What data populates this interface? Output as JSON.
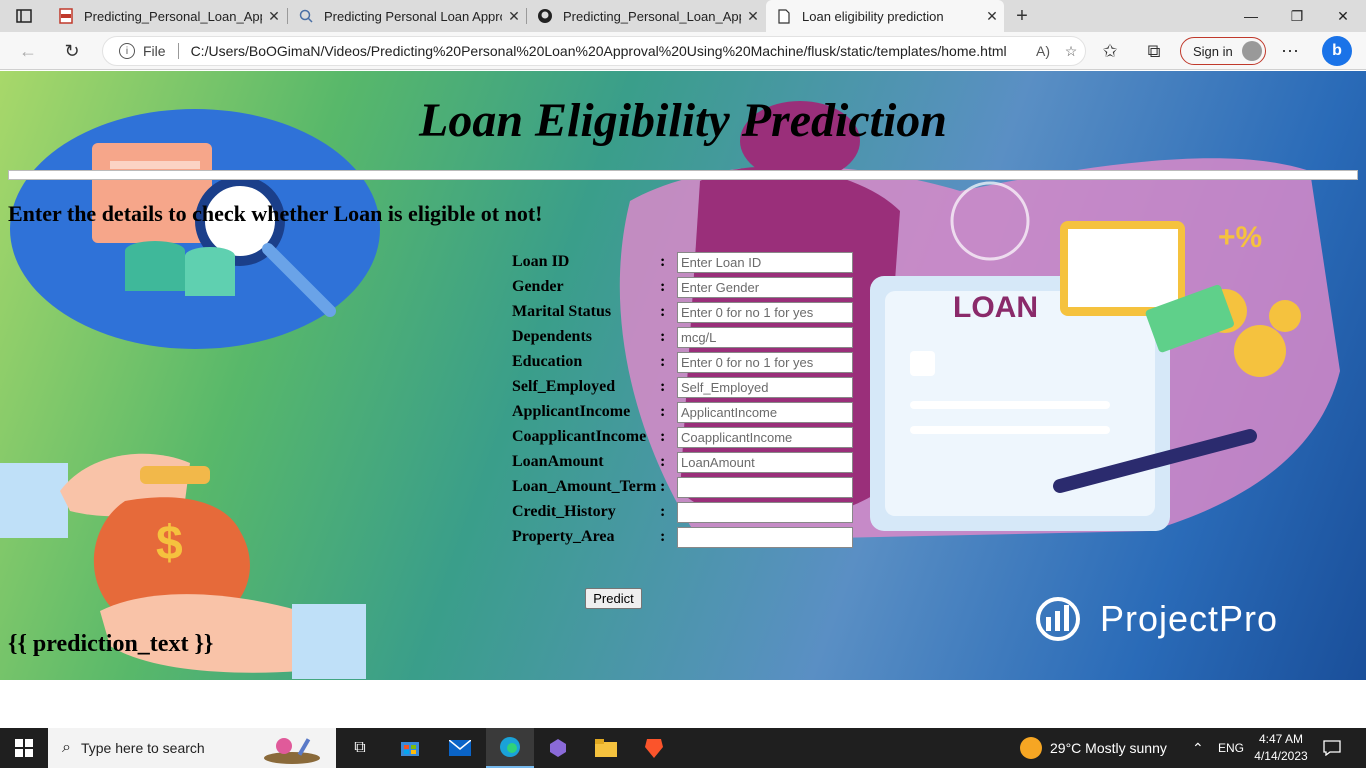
{
  "browser": {
    "tabs": [
      {
        "title": "Predicting_Personal_Loan_Appro",
        "icon": "pdf-icon"
      },
      {
        "title": "Predicting Personal Loan Approv",
        "icon": "search-icon"
      },
      {
        "title": "Predicting_Personal_Loan_Appro",
        "icon": "github-icon"
      },
      {
        "title": "Loan eligibility prediction",
        "icon": "document-icon",
        "active": true
      }
    ],
    "file_label": "File",
    "url": "C:/Users/BoOGimaN/Videos/Predicting%20Personal%20Loan%20Approval%20Using%20Machine/flusk/static/templates/home.html",
    "signin_label": "Sign in"
  },
  "page": {
    "title": "Loan Eligibility Prediction",
    "subtitle": "Enter the details to check whether Loan is eligible ot not!",
    "colon": ":",
    "fields": [
      {
        "label": "Loan ID",
        "placeholder": "Enter Loan ID"
      },
      {
        "label": "Gender",
        "placeholder": "Enter Gender"
      },
      {
        "label": "Marital Status",
        "placeholder": "Enter 0 for no 1 for yes"
      },
      {
        "label": "Dependents",
        "placeholder": "mcg/L"
      },
      {
        "label": "Education",
        "placeholder": "Enter 0 for no 1 for yes"
      },
      {
        "label": "Self_Employed",
        "placeholder": "Self_Employed"
      },
      {
        "label": "ApplicantIncome",
        "placeholder": "ApplicantIncome"
      },
      {
        "label": "CoapplicantIncome",
        "placeholder": "CoapplicantIncome"
      },
      {
        "label": "LoanAmount",
        "placeholder": "LoanAmount"
      },
      {
        "label": "Loan_Amount_Term",
        "placeholder": ""
      },
      {
        "label": "Credit_History",
        "placeholder": ""
      },
      {
        "label": "Property_Area",
        "placeholder": ""
      }
    ],
    "predict_label": "Predict",
    "prediction_text": "{{ prediction_text }}",
    "art_loan_label": "LOAN",
    "art_percent": "+%",
    "art_dollar": "$",
    "logo_text": "ProjectPro"
  },
  "taskbar": {
    "search_placeholder": "Type here to search",
    "weather": "29°C  Mostly sunny",
    "language": "ENG",
    "time": "4:47 AM",
    "date": "4/14/2023"
  },
  "colors": {
    "accent_signin": "#c0392b",
    "taskbar": "#1f1f1f"
  }
}
